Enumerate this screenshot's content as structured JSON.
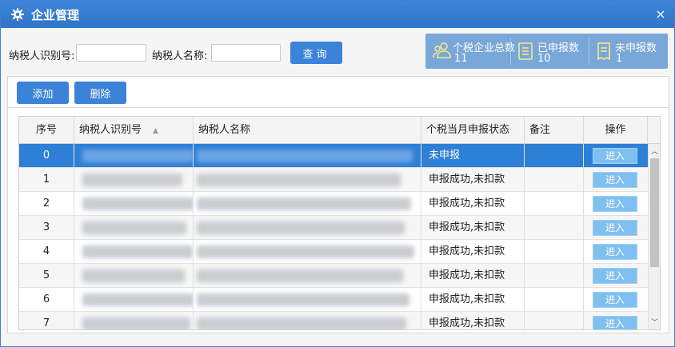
{
  "window": {
    "title": "企业管理",
    "close": "×"
  },
  "search": {
    "id_label": "纳税人识别号:",
    "id_value": "",
    "name_label": "纳税人名称:",
    "name_value": "",
    "query_label": "查询"
  },
  "stats": {
    "total_label": "个税企业总数",
    "total_value": "11",
    "declared_label": "已申报数",
    "declared_value": "10",
    "undeclared_label": "未申报数",
    "undeclared_value": "1"
  },
  "toolbar": {
    "add_label": "添加",
    "delete_label": "删除"
  },
  "table": {
    "columns": {
      "index": "序号",
      "taxpayer_id": "纳税人识别号",
      "taxpayer_name": "纳税人名称",
      "status": "个税当月申报状态",
      "remark": "备注",
      "action": "操作"
    },
    "rows": [
      {
        "index": "0",
        "status": "未申报",
        "remark": "",
        "action": "进入"
      },
      {
        "index": "1",
        "status": "申报成功,未扣款",
        "remark": "",
        "action": "进入"
      },
      {
        "index": "2",
        "status": "申报成功,未扣款",
        "remark": "",
        "action": "进入"
      },
      {
        "index": "3",
        "status": "申报成功,未扣款",
        "remark": "",
        "action": "进入"
      },
      {
        "index": "4",
        "status": "申报成功,未扣款",
        "remark": "",
        "action": "进入"
      },
      {
        "index": "5",
        "status": "申报成功,未扣款",
        "remark": "",
        "action": "进入"
      },
      {
        "index": "6",
        "status": "申报成功,未扣款",
        "remark": "",
        "action": "进入"
      },
      {
        "index": "7",
        "status": "申报成功,未扣款",
        "remark": "",
        "action": "进入"
      }
    ]
  },
  "icons": {
    "title": "gear-icon",
    "close": "close-icon",
    "total": "users-icon",
    "declared": "document-icon",
    "undeclared": "receipt-icon",
    "sort": "sort-asc-icon"
  },
  "colors": {
    "titlebar": "#2f74c8",
    "primary_button": "#3b82d9",
    "selected_row": "#2e7fd6",
    "stats_panel": "#78a7d8",
    "enter_button": "#7fc0f0",
    "stats_icon": "#f7e98a"
  }
}
